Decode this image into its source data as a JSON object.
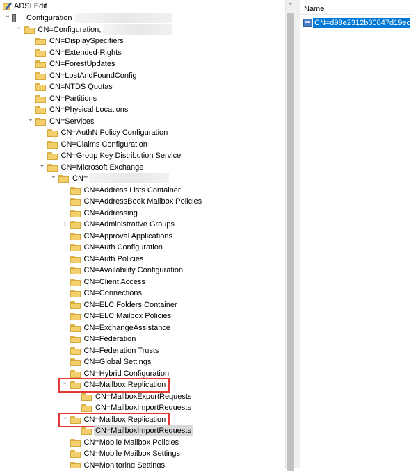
{
  "tree": {
    "root_label": "ADSI Edit",
    "items": [
      {
        "label": "Configuration",
        "depth": 0,
        "toggle": "expanded",
        "icon": "server-icon"
      },
      {
        "label": "CN=Configuration,",
        "depth": 1,
        "toggle": "expanded"
      },
      {
        "label": "CN=DisplaySpecifiers",
        "depth": 2,
        "toggle": "none"
      },
      {
        "label": "CN=Extended-Rights",
        "depth": 2,
        "toggle": "none"
      },
      {
        "label": "CN=ForestUpdates",
        "depth": 2,
        "toggle": "none"
      },
      {
        "label": "CN=LostAndFoundConfig",
        "depth": 2,
        "toggle": "none"
      },
      {
        "label": "CN=NTDS Quotas",
        "depth": 2,
        "toggle": "none"
      },
      {
        "label": "CN=Partitions",
        "depth": 2,
        "toggle": "none"
      },
      {
        "label": "CN=Physical Locations",
        "depth": 2,
        "toggle": "none"
      },
      {
        "label": "CN=Services",
        "depth": 2,
        "toggle": "expanded"
      },
      {
        "label": "CN=AuthN Policy Configuration",
        "depth": 3,
        "toggle": "none"
      },
      {
        "label": "CN=Claims Configuration",
        "depth": 3,
        "toggle": "none"
      },
      {
        "label": "CN=Group Key Distribution Service",
        "depth": 3,
        "toggle": "none"
      },
      {
        "label": "CN=Microsoft Exchange",
        "depth": 3,
        "toggle": "expanded"
      },
      {
        "label": "CN=",
        "depth": 4,
        "toggle": "expanded"
      },
      {
        "label": "CN=Address Lists Container",
        "depth": 5,
        "toggle": "none"
      },
      {
        "label": "CN=AddressBook Mailbox Policies",
        "depth": 5,
        "toggle": "none"
      },
      {
        "label": "CN=Addressing",
        "depth": 5,
        "toggle": "none"
      },
      {
        "label": "CN=Administrative Groups",
        "depth": 5,
        "toggle": "collapsed"
      },
      {
        "label": "CN=Approval Applications",
        "depth": 5,
        "toggle": "none"
      },
      {
        "label": "CN=Auth Configuration",
        "depth": 5,
        "toggle": "none"
      },
      {
        "label": "CN=Auth Policies",
        "depth": 5,
        "toggle": "none"
      },
      {
        "label": "CN=Availability Configuration",
        "depth": 5,
        "toggle": "none"
      },
      {
        "label": "CN=Client Access",
        "depth": 5,
        "toggle": "none"
      },
      {
        "label": "CN=Connections",
        "depth": 5,
        "toggle": "none"
      },
      {
        "label": "CN=ELC Folders Container",
        "depth": 5,
        "toggle": "none"
      },
      {
        "label": "CN=ELC Mailbox Policies",
        "depth": 5,
        "toggle": "none"
      },
      {
        "label": "CN=ExchangeAssistance",
        "depth": 5,
        "toggle": "none"
      },
      {
        "label": "CN=Federation",
        "depth": 5,
        "toggle": "none"
      },
      {
        "label": "CN=Federation Trusts",
        "depth": 5,
        "toggle": "none"
      },
      {
        "label": "CN=Global Settings",
        "depth": 5,
        "toggle": "none"
      },
      {
        "label": "CN=Hybrid Configuration",
        "depth": 5,
        "toggle": "none"
      },
      {
        "label": "CN=Mailbox Replication",
        "depth": 5,
        "toggle": "expanded",
        "highlight": true
      },
      {
        "label": "CN=MailboxExportRequests",
        "depth": 6,
        "toggle": "none"
      },
      {
        "label": "CN=MailboxImportRequests",
        "depth": 6,
        "toggle": "none"
      },
      {
        "label": "CN=Mailbox Replication",
        "depth": 5,
        "toggle": "expanded",
        "highlight": true
      },
      {
        "label": "CN=MailboxImportRequests",
        "depth": 6,
        "toggle": "none",
        "selected": true
      },
      {
        "label": "CN=Mobile Mailbox Policies",
        "depth": 5,
        "toggle": "none"
      },
      {
        "label": "CN=Mobile Mailbox Settings",
        "depth": 5,
        "toggle": "none"
      },
      {
        "label": "CN=Monitoring Settings",
        "depth": 5,
        "toggle": "none"
      }
    ]
  },
  "details": {
    "column_header": "Name",
    "selected_item": "CN=d98e2312b30847d19ec..."
  },
  "colors": {
    "selection": "#0078d7",
    "highlight_box": "#e53935",
    "folder": "#f3cf6e"
  }
}
